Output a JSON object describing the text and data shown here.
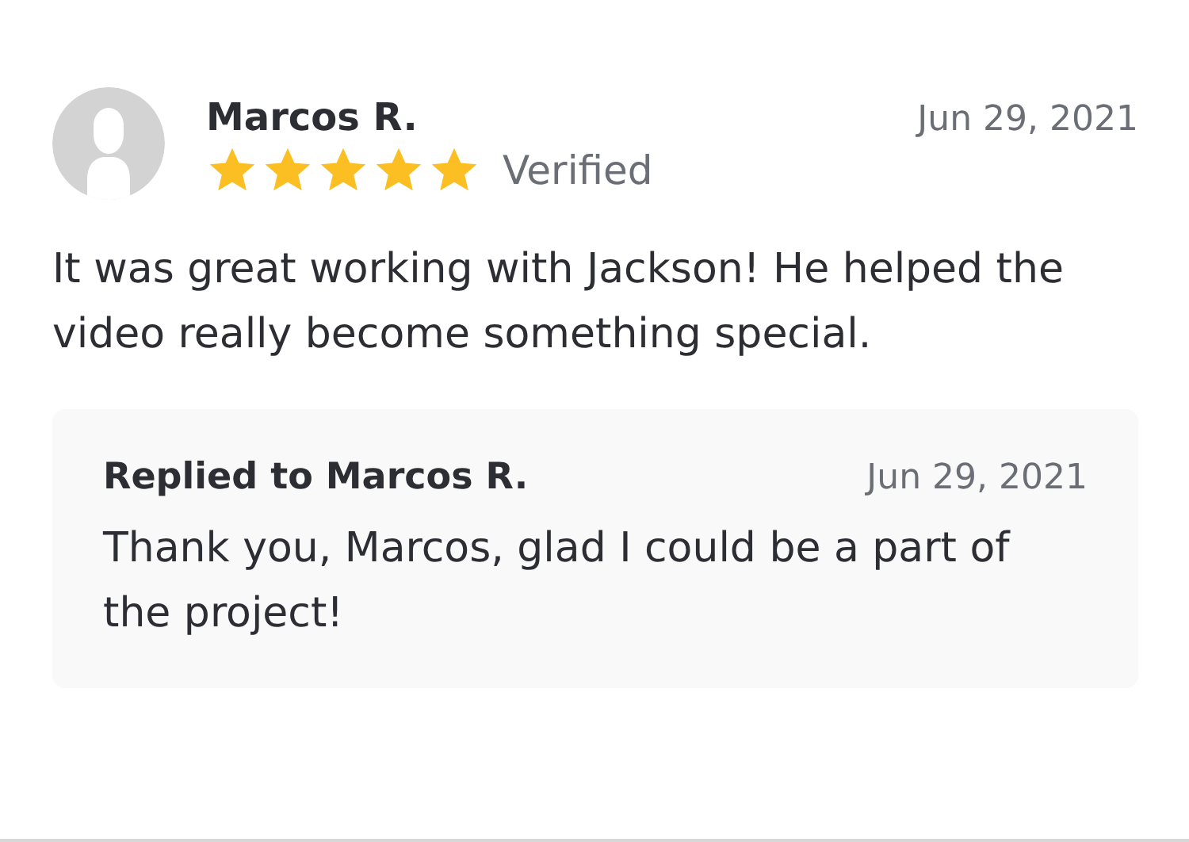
{
  "review": {
    "author": "Marcos R.",
    "date": "Jun 29, 2021",
    "stars": 5,
    "badge": "Verified",
    "text": "It was great working with Jackson! He helped the video really become something special."
  },
  "reply": {
    "title": "Replied to Marcos R.",
    "date": "Jun 29, 2021",
    "text": "Thank you, Marcos, glad I could be a part of the project!"
  }
}
